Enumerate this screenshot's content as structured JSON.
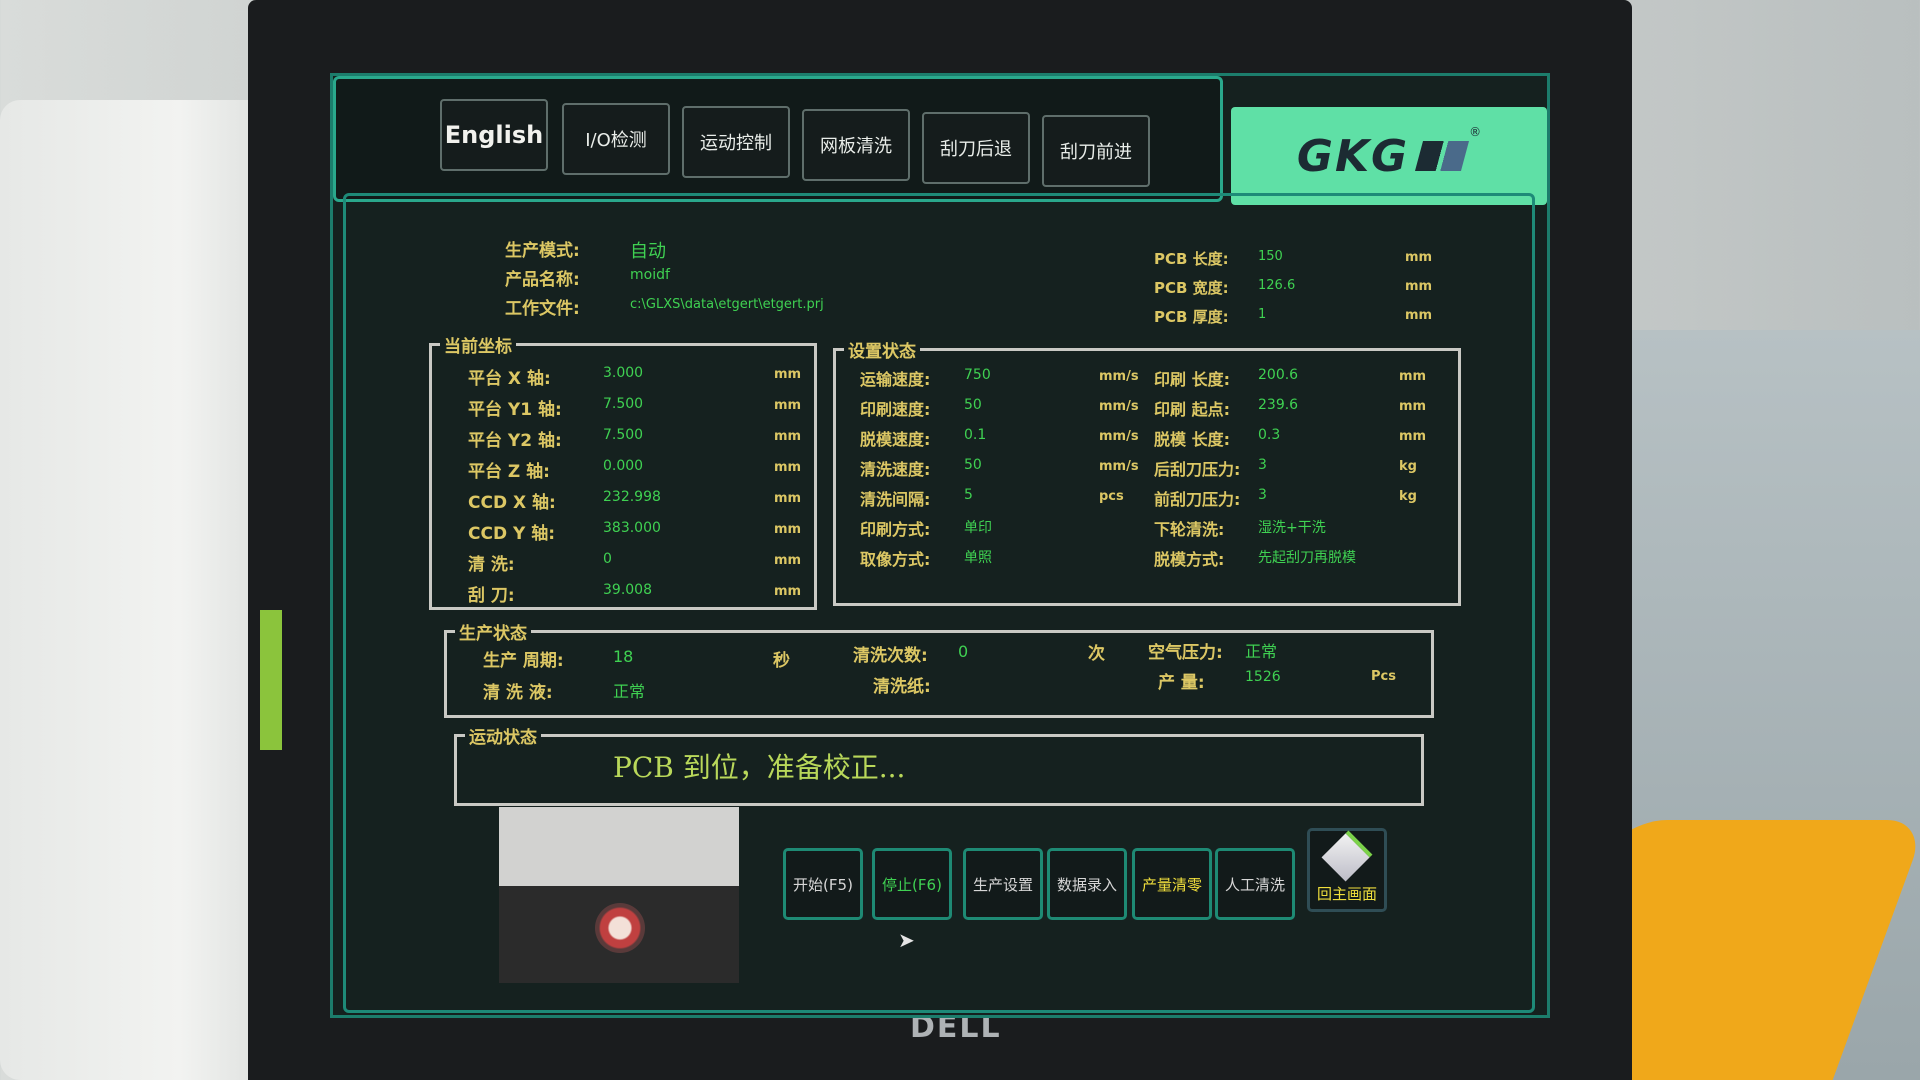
{
  "tabs": [
    {
      "label": "English"
    },
    {
      "label": "I/O检测"
    },
    {
      "label": "运动控制"
    },
    {
      "label": "网板清洗"
    },
    {
      "label": "刮刀后退"
    },
    {
      "label": "刮刀前进"
    }
  ],
  "brand": {
    "name": "GKG",
    "mark": "®"
  },
  "header": {
    "mode_label": "生产模式:",
    "mode_value": "自动",
    "product_label": "产品名称:",
    "product_value": "moidf",
    "file_label": "工作文件:",
    "file_value": "c:\\GLXS\\data\\etgert\\etgert.prj"
  },
  "pcb": [
    {
      "label": "PCB 长度:",
      "value": "150",
      "unit": "mm"
    },
    {
      "label": "PCB 宽度:",
      "value": "126.6",
      "unit": "mm"
    },
    {
      "label": "PCB 厚度:",
      "value": "1",
      "unit": "mm"
    }
  ],
  "coords": {
    "title": "当前坐标",
    "rows": [
      {
        "label": "平台 X 轴:",
        "value": "3.000",
        "unit": "mm"
      },
      {
        "label": "平台 Y1 轴:",
        "value": "7.500",
        "unit": "mm"
      },
      {
        "label": "平台 Y2 轴:",
        "value": "7.500",
        "unit": "mm"
      },
      {
        "label": "平台 Z 轴:",
        "value": "0.000",
        "unit": "mm"
      },
      {
        "label": "CCD X 轴:",
        "value": "232.998",
        "unit": "mm"
      },
      {
        "label": "CCD Y 轴:",
        "value": "383.000",
        "unit": "mm"
      },
      {
        "label": "清    洗:",
        "value": "0",
        "unit": "mm"
      },
      {
        "label": "刮    刀:",
        "value": "39.008",
        "unit": "mm"
      }
    ]
  },
  "settings": {
    "title": "设置状态",
    "left": [
      {
        "label": "运输速度:",
        "value": "750",
        "unit": "mm/s"
      },
      {
        "label": "印刷速度:",
        "value": "50",
        "unit": "mm/s"
      },
      {
        "label": "脱模速度:",
        "value": "0.1",
        "unit": "mm/s"
      },
      {
        "label": "清洗速度:",
        "value": "50",
        "unit": "mm/s"
      },
      {
        "label": "清洗间隔:",
        "value": "5",
        "unit": "pcs"
      },
      {
        "label": "印刷方式:",
        "value": "单印",
        "unit": ""
      },
      {
        "label": "取像方式:",
        "value": "单照",
        "unit": ""
      }
    ],
    "right": [
      {
        "label": "印刷 长度:",
        "value": "200.6",
        "unit": "mm"
      },
      {
        "label": "印刷 起点:",
        "value": "239.6",
        "unit": "mm"
      },
      {
        "label": "脱模 长度:",
        "value": "0.3",
        "unit": "mm"
      },
      {
        "label": "后刮刀压力:",
        "value": "3",
        "unit": "kg"
      },
      {
        "label": "前刮刀压力:",
        "value": "3",
        "unit": "kg"
      },
      {
        "label": "下轮清洗:",
        "value": "湿洗+干洗",
        "unit": ""
      },
      {
        "label": "脱模方式:",
        "value": "先起刮刀再脱模",
        "unit": ""
      }
    ]
  },
  "production": {
    "title": "生产状态",
    "cycle_label": "生产 周期:",
    "cycle_value": "18",
    "cycle_unit": "秒",
    "clean_count_label": "清洗次数:",
    "clean_count_value": "0",
    "clean_count_unit": "次",
    "air_label": "空气压力:",
    "air_value": "正常",
    "solvent_label": "清 洗 液:",
    "solvent_value": "正常",
    "paper_label": "清洗纸:",
    "output_label": "产    量:",
    "output_value": "1526",
    "output_unit": "Pcs"
  },
  "motion": {
    "title": "运动状态",
    "message": "PCB 到位，准备校正..."
  },
  "buttons": [
    {
      "label": "开始(F5)",
      "color": "#d6d6d6"
    },
    {
      "label": "停止(F6)",
      "color": "#3fd152"
    },
    {
      "label": "生产设置",
      "color": "#d6d6d6"
    },
    {
      "label": "数据录入",
      "color": "#d6d6d6"
    },
    {
      "label": "产量清零",
      "color": "#f0df3c"
    },
    {
      "label": "人工清洗",
      "color": "#d6d6d6"
    },
    {
      "label": "回主画面",
      "color": "#f0df3c",
      "icon": "home-icon"
    }
  ],
  "monitor_brand": "DELL",
  "colors": {
    "label": "#dcc764",
    "value": "#3fd152",
    "frame": "#1e8a78",
    "brand_panel": "#5fe0a6"
  }
}
